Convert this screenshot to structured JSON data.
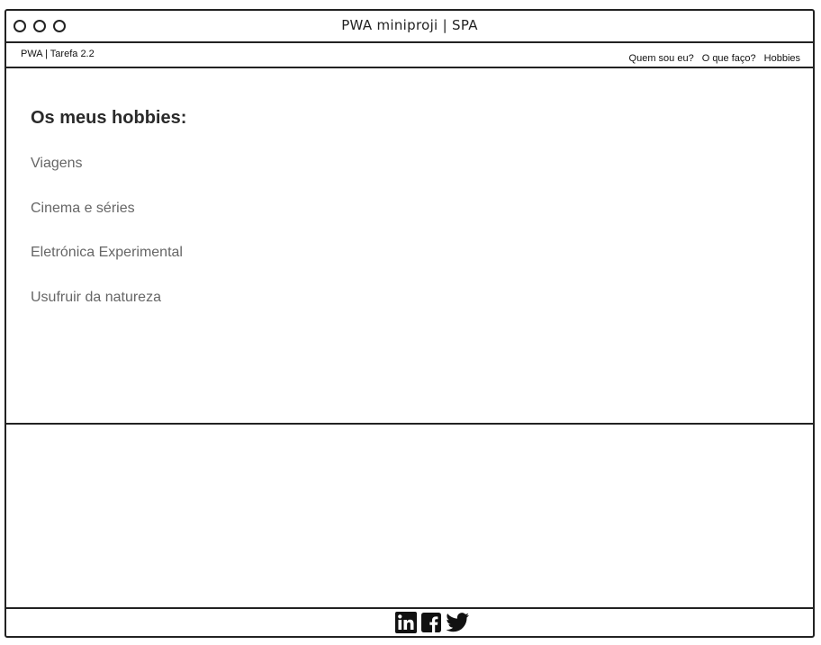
{
  "window": {
    "title": "PWA miniproji | SPA"
  },
  "navbar": {
    "brand": "PWA | Tarefa 2.2",
    "links": [
      {
        "label": "Quem sou eu?"
      },
      {
        "label": "O que faço?"
      },
      {
        "label": "Hobbies"
      }
    ]
  },
  "main": {
    "heading": "Os meus hobbies:",
    "hobbies": [
      "Viagens",
      "Cinema e séries",
      "Eletrónica Experimental",
      "Usufruir da natureza"
    ]
  },
  "footer": {
    "social_icons": [
      "linkedin-icon",
      "facebook-icon",
      "twitter-icon"
    ]
  },
  "colors": {
    "border": "#222222",
    "heading": "#2a2a2a",
    "list_text": "#666666",
    "background": "#ffffff"
  }
}
